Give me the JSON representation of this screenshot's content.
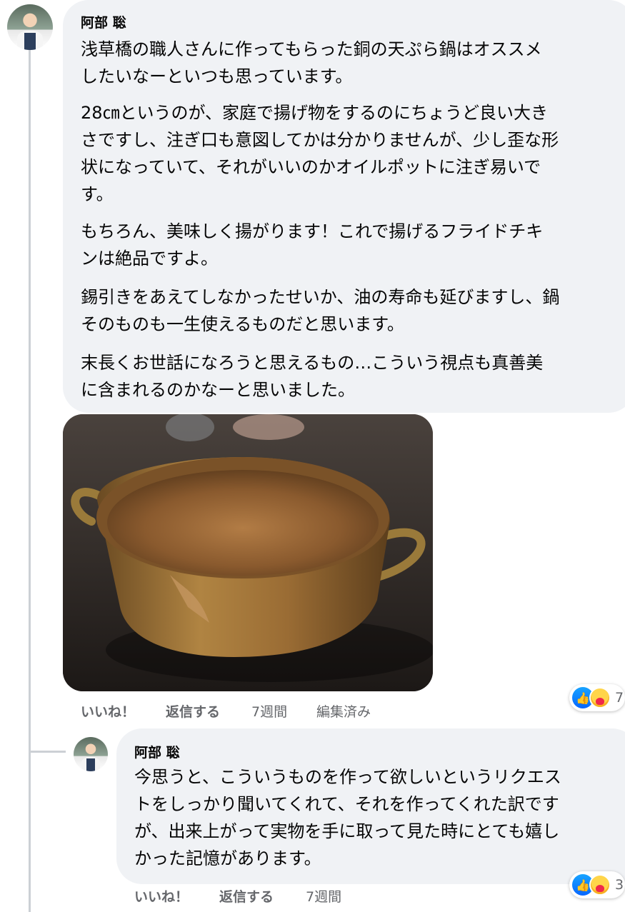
{
  "comment": {
    "author": "阿部 聡",
    "paragraphs": [
      "浅草橋の職人さんに作ってもらった銅の天ぷら鍋はオススメ\nしたいなーといつも思っています。",
      "28㎝というのが、家庭で揚げ物をするのにちょうど良い大き\nさですし、注ぎ口も意図してかは分かりませんが、少し歪な形\n状になっていて、それがいいのかオイルポットに注ぎ易いで\nす。",
      "もちろん、美味しく揚がります！これで揚げるフライドチキ\nンは絶品ですよ。",
      "錫引きをあえてしなかったせいか、油の寿命も延びますし、鍋\nそのものも一生使えるものだと思います。",
      "末長くお世話になろうと思えるもの…こういう視点も真善美\nに含まれるのかなーと思いました。"
    ],
    "photo_icon": "copper-tempura-pot-photo",
    "actions": {
      "like": "いいね！",
      "reply": "返信する",
      "time": "7週間",
      "edited": "編集済み"
    },
    "reactions": {
      "icons": [
        "like-icon",
        "care-icon"
      ],
      "count": "7"
    }
  },
  "reply": {
    "author": "阿部 聡",
    "text": "今思うと、こういうものを作って欲しいというリクエス\nトをしっかり聞いてくれて、それを作ってくれた訳です\nが、出来上がって実物を手に取って見た時にとても嬉し\nかった記憶があります。",
    "actions": {
      "like": "いいね！",
      "reply": "返信する",
      "time": "7週間"
    },
    "reactions": {
      "icons": [
        "like-icon",
        "care-icon"
      ],
      "count": "3"
    }
  },
  "colors": {
    "bubble": "#f0f2f5",
    "action_text": "#65676b",
    "like_blue": "#0866ff"
  }
}
